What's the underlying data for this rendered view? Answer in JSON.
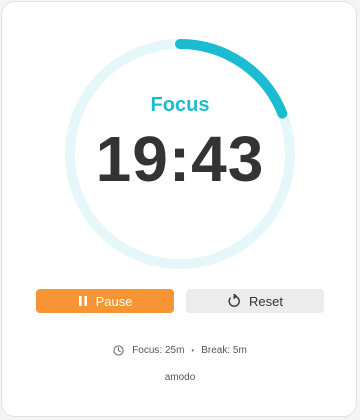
{
  "timer": {
    "mode_label": "Focus",
    "time_display": "19:43",
    "progress_fraction": 0.19
  },
  "controls": {
    "pause_label": "Pause",
    "reset_label": "Reset",
    "pause_icon": "pause-icon",
    "reset_icon": "reset-icon"
  },
  "settings": {
    "icon": "clock-icon",
    "focus_text": "Focus: 25m",
    "separator": "•",
    "break_text": "Break: 5m"
  },
  "brand": "amodo",
  "colors": {
    "accent": "#1bbcd2",
    "ring_track": "#e6f7fa",
    "pause_button": "#f79433",
    "reset_button": "#ececec",
    "timer_text": "#333333"
  }
}
